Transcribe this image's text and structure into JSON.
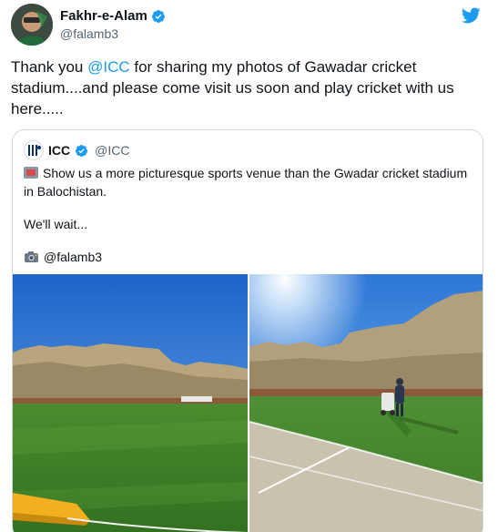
{
  "author": {
    "name": "Fakhr-e-Alam",
    "handle": "@falamb3"
  },
  "tweet": {
    "text_before": "Thank you ",
    "mention": "@ICC",
    "text_after": " for sharing my photos of Gawadar cricket stadium....and please come visit us soon and play cricket with us here....."
  },
  "quote": {
    "name": "ICC",
    "handle": "@ICC",
    "line1": "Show us a more picturesque sports venue than the Gwadar cricket stadium in Balochistan.",
    "line2": "We'll wait...",
    "line3": "@falamb3"
  },
  "icons": {
    "brand": "twitter-bird-icon",
    "verified": "verified-badge-icon",
    "camera": "camera-emoji-icon",
    "stadium": "stadium-emoji-icon"
  },
  "colors": {
    "accent": "#1d9bf0",
    "text": "#0f1419",
    "muted": "#536471",
    "border": "#cfd9de"
  }
}
